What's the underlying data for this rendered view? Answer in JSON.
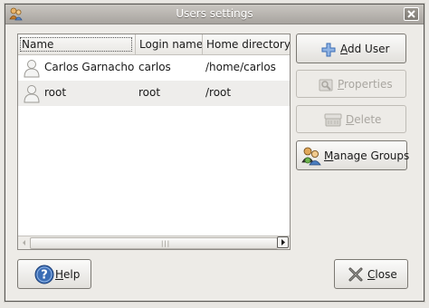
{
  "window": {
    "title": "Users settings"
  },
  "list": {
    "columns": [
      "Name",
      "Login name",
      "Home directory"
    ],
    "rows": [
      {
        "name": "Carlos Garnacho",
        "login": "carlos",
        "home": "/home/carlos"
      },
      {
        "name": "root",
        "login": "root",
        "home": "/root"
      }
    ]
  },
  "buttons": {
    "add_user": {
      "mnemonic": "A",
      "rest": "dd User"
    },
    "properties": {
      "mnemonic": "P",
      "rest": "roperties"
    },
    "delete": {
      "mnemonic": "D",
      "rest": "elete"
    },
    "manage_groups": {
      "mnemonic": "M",
      "rest": "anage Groups"
    },
    "help": {
      "mnemonic": "H",
      "rest": "elp"
    },
    "close": {
      "mnemonic": "C",
      "rest": "lose"
    }
  },
  "icons": {
    "app": "users-app-icon",
    "close": "close-icon",
    "avatar": "user-avatar-icon",
    "add": "plus-icon",
    "properties": "properties-icon",
    "delete": "delete-icon",
    "groups": "group-icon",
    "help": "help-icon",
    "close_button": "x-icon"
  },
  "colors": {
    "accent_blue": "#3b6db5",
    "row_alt": "#eeedeb"
  }
}
